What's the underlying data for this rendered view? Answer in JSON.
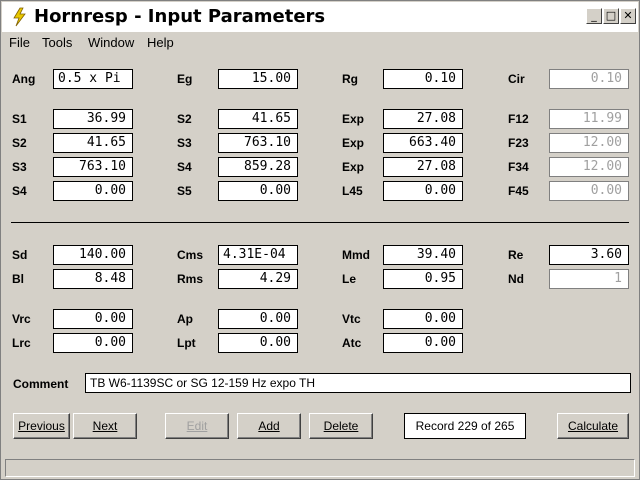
{
  "window": {
    "title": "Hornresp - Input Parameters"
  },
  "titlebar_buttons": {
    "minimize": "_",
    "maximize": "□",
    "close": "✕"
  },
  "menu": [
    "File",
    "Tools",
    "Window",
    "Help"
  ],
  "params": {
    "Ang": "0.5 x Pi",
    "Eg": "15.00",
    "Rg": "0.10",
    "Cir": "0.10",
    "S1": "36.99",
    "S2_top": "41.65",
    "Exp1": "27.08",
    "F12": "11.99",
    "S2": "41.65",
    "S3_mid": "763.10",
    "Exp2": "663.40",
    "F23": "12.00",
    "S3": "763.10",
    "S4_mid": "859.28",
    "Exp3": "27.08",
    "F34": "12.00",
    "S4": "0.00",
    "S5": "0.00",
    "L45": "0.00",
    "F45": "0.00",
    "Sd": "140.00",
    "Cms": "4.31E-04",
    "Mmd": "39.40",
    "Re": "3.60",
    "Bl": "8.48",
    "Rms": "4.29",
    "Le": "0.95",
    "Nd": "1",
    "Vrc": "0.00",
    "Ap": "0.00",
    "Vtc": "0.00",
    "Lrc": "0.00",
    "Lpt": "0.00",
    "Atc": "0.00"
  },
  "labels": {
    "Ang": "Ang",
    "Eg": "Eg",
    "Rg": "Rg",
    "Cir": "Cir",
    "S1": "S1",
    "S2": "S2",
    "S3": "S3",
    "S4": "S4",
    "S5": "S5",
    "Exp": "Exp",
    "L45": "L45",
    "F12": "F12",
    "F23": "F23",
    "F34": "F34",
    "F45": "F45",
    "Sd": "Sd",
    "Cms": "Cms",
    "Mmd": "Mmd",
    "Re": "Re",
    "Bl": "Bl",
    "Rms": "Rms",
    "Le": "Le",
    "Nd": "Nd",
    "Vrc": "Vrc",
    "Ap": "Ap",
    "Vtc": "Vtc",
    "Lrc": "Lrc",
    "Lpt": "Lpt",
    "Atc": "Atc",
    "Comment": "Comment"
  },
  "comment": "TB W6-1139SC or SG 12-159 Hz expo TH",
  "buttons": {
    "previous": "Previous",
    "next": "Next",
    "edit": "Edit",
    "add": "Add",
    "delete": "Delete",
    "calculate": "Calculate"
  },
  "record": "Record 229 of 265",
  "colors": {
    "field_bg": "#ffffff",
    "window_bg": "#d4d0c8",
    "disabled_text": "#a0a0a0",
    "icon": "#e8c800"
  }
}
